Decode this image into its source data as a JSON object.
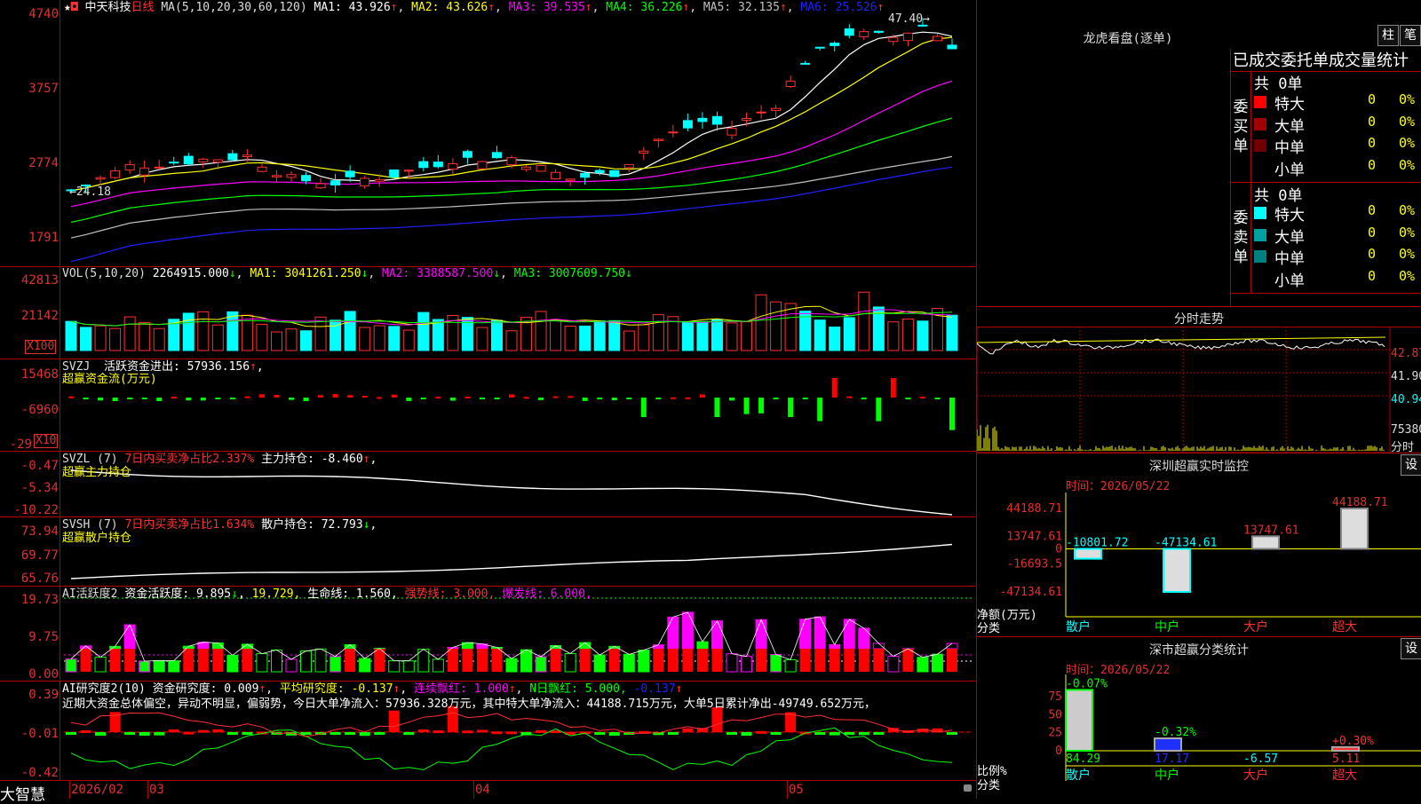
{
  "app": {
    "brand": "大智慧",
    "stock": "中天科技",
    "period": "日线"
  },
  "main_panel": {
    "ma_header": "MA(5,10,20,30,60,120)",
    "ma": [
      {
        "label": "MA1:",
        "value": "43.926",
        "arrow": "↑",
        "color": "#ffffff"
      },
      {
        "label": "MA2:",
        "value": "43.626",
        "arrow": "↑",
        "color": "#ffff00"
      },
      {
        "label": "MA3:",
        "value": "39.535",
        "arrow": "↑",
        "color": "#ff00ff"
      },
      {
        "label": "MA4:",
        "value": "36.226",
        "arrow": "↑",
        "color": "#00ff00"
      },
      {
        "label": "MA5:",
        "value": "32.135",
        "arrow": "↑",
        "color": "#c0c0c0"
      },
      {
        "label": "MA6:",
        "value": "25.526",
        "arrow": "↑",
        "color": "#2020ff"
      }
    ],
    "y_ticks": [
      "4740",
      "3757",
      "2774",
      "1791"
    ],
    "high_label": "47.40",
    "low_label": "24.18"
  },
  "vol_panel": {
    "header": "VOL(5,10,20)",
    "value": "2264915.000",
    "ma": [
      {
        "label": "MA1:",
        "value": "3041261.250",
        "color": "#ffff00"
      },
      {
        "label": "MA2:",
        "value": "3388587.500",
        "color": "#ff00ff"
      },
      {
        "label": "MA3:",
        "value": "3007609.750",
        "color": "#00ff00"
      }
    ],
    "y_ticks": [
      "42813",
      "21142"
    ],
    "unit": "X100"
  },
  "svzj_panel": {
    "name": "SVZJ",
    "label": "活跃资金进出:",
    "value": "57936.156",
    "sub": "超赢资金流(万元)",
    "y_ticks": [
      "15468",
      "-6960",
      "-29"
    ],
    "unit": "X10"
  },
  "svzl_panel": {
    "name": "SVZL (7)",
    "red_text": "7日内买卖净占比2.337%",
    "label": "主力持仓:",
    "value": "-8.460",
    "sub": "超赢主力持仓",
    "y_ticks": [
      "-0.47",
      "-5.34",
      "-10.22"
    ]
  },
  "svsh_panel": {
    "name": "SVSH (7)",
    "red_text": "7日内买卖净占比1.634%",
    "label": "散户持仓:",
    "value": "72.793",
    "sub": "超赢散户持仓",
    "y_ticks": [
      "73.94",
      "69.77",
      "65.76"
    ]
  },
  "ai2_panel": {
    "name": "AI活跃度2",
    "label1": "资金活跃度:",
    "v1": "9.895",
    "v2": "19.729,",
    "label3": "生命线:",
    "v3": "1.560,",
    "label4": "强势线:",
    "v4": "3.000,",
    "label5": "爆发线:",
    "v5": "6.000,",
    "y_ticks": [
      "19.73",
      "9.75",
      "0.00"
    ]
  },
  "ai_research_panel": {
    "name": "AI研究度2(10)",
    "label1": "资金研究度:",
    "v1": "0.009",
    "label2": "平均研究度:",
    "v2": "-0.137",
    "label3": "连续飘红:",
    "v3": "1.000",
    "label4": "N日飘红:",
    "v4": "5.000,",
    "v5": "-0.137",
    "summary": "近期大资金总体偏空，异动不明显，偏弱势，今日大单净流入：57936.328万元，其中特大单净流入：44188.715万元，大单5日累计净出-49749.652万元，",
    "y_ticks": [
      "0.39",
      "-0.01",
      "-0.42"
    ]
  },
  "x_axis": {
    "labels": [
      "2026/02",
      "03",
      "04",
      "05"
    ]
  },
  "longhu": {
    "title": "龙虎看盘(逐单)",
    "btn1": "柱",
    "btn2": "笔",
    "header": "已成交委托单成交量统计",
    "buy_label": "委买单",
    "sell_label": "委卖单",
    "buy_total": "共 0单",
    "sell_total": "共 0单",
    "buy_rows": [
      {
        "name": "特大",
        "count": "0",
        "pct": "0%",
        "color": "#ff0000"
      },
      {
        "name": "大单",
        "count": "0",
        "pct": "0%",
        "color": "#a00000"
      },
      {
        "name": "中单",
        "count": "0",
        "pct": "0%",
        "color": "#700000"
      },
      {
        "name": "小单",
        "count": "0",
        "pct": "0%",
        "color": "#000000"
      }
    ],
    "sell_rows": [
      {
        "name": "特大",
        "count": "0",
        "pct": "0%",
        "color": "#00ffff"
      },
      {
        "name": "大单",
        "count": "0",
        "pct": "0%",
        "color": "#00a0a0"
      },
      {
        "name": "中单",
        "count": "0",
        "pct": "0%",
        "color": "#008080"
      },
      {
        "name": "小单",
        "count": "0",
        "pct": "0%",
        "color": "#000000"
      }
    ]
  },
  "intraday": {
    "title": "分时走势",
    "prices": [
      "42.87",
      "41.90",
      "40.94"
    ],
    "volume": "75380",
    "vol_label": "分时"
  },
  "sz_monitor": {
    "title": "深圳超赢实时监控",
    "btn": "设",
    "time_label": "时间：2026/05/22",
    "y_ticks": [
      "44188.71",
      "13747.61",
      "0",
      "-16693.5",
      "-47134.61"
    ],
    "axis_label1": "净额(万元)",
    "axis_label2": "分类",
    "bars": [
      {
        "name": "散户",
        "value": -10801.72,
        "label": "-10801.72"
      },
      {
        "name": "中户",
        "value": -47134.61,
        "label": "-47134.61"
      },
      {
        "name": "大户",
        "value": 13747.61,
        "label": "13747.61"
      },
      {
        "name": "超大",
        "value": 44188.71,
        "label": "44188.71"
      }
    ]
  },
  "sz_class": {
    "title": "深市超赢分类统计",
    "btn": "设",
    "time_label": "时间：2026/05/22",
    "y_ticks": [
      "75",
      "50",
      "25",
      "0"
    ],
    "axis_label1": "比例%",
    "axis_label2": "分类",
    "bars": [
      {
        "name": "散户",
        "value": 84.29,
        "label": "84.29",
        "delta": "-0.07%",
        "delta_color": "#00ff00"
      },
      {
        "name": "中户",
        "value": 17.17,
        "label": "17.17",
        "delta": "-0.32%",
        "delta_color": "#00ff00"
      },
      {
        "name": "大户",
        "value": -6.57,
        "label": "-6.57",
        "delta": "",
        "delta_color": "#00ff00"
      },
      {
        "name": "超大",
        "value": 5.11,
        "label": "5.11",
        "delta": "+0.30%",
        "delta_color": "#ff3030"
      }
    ]
  }
}
